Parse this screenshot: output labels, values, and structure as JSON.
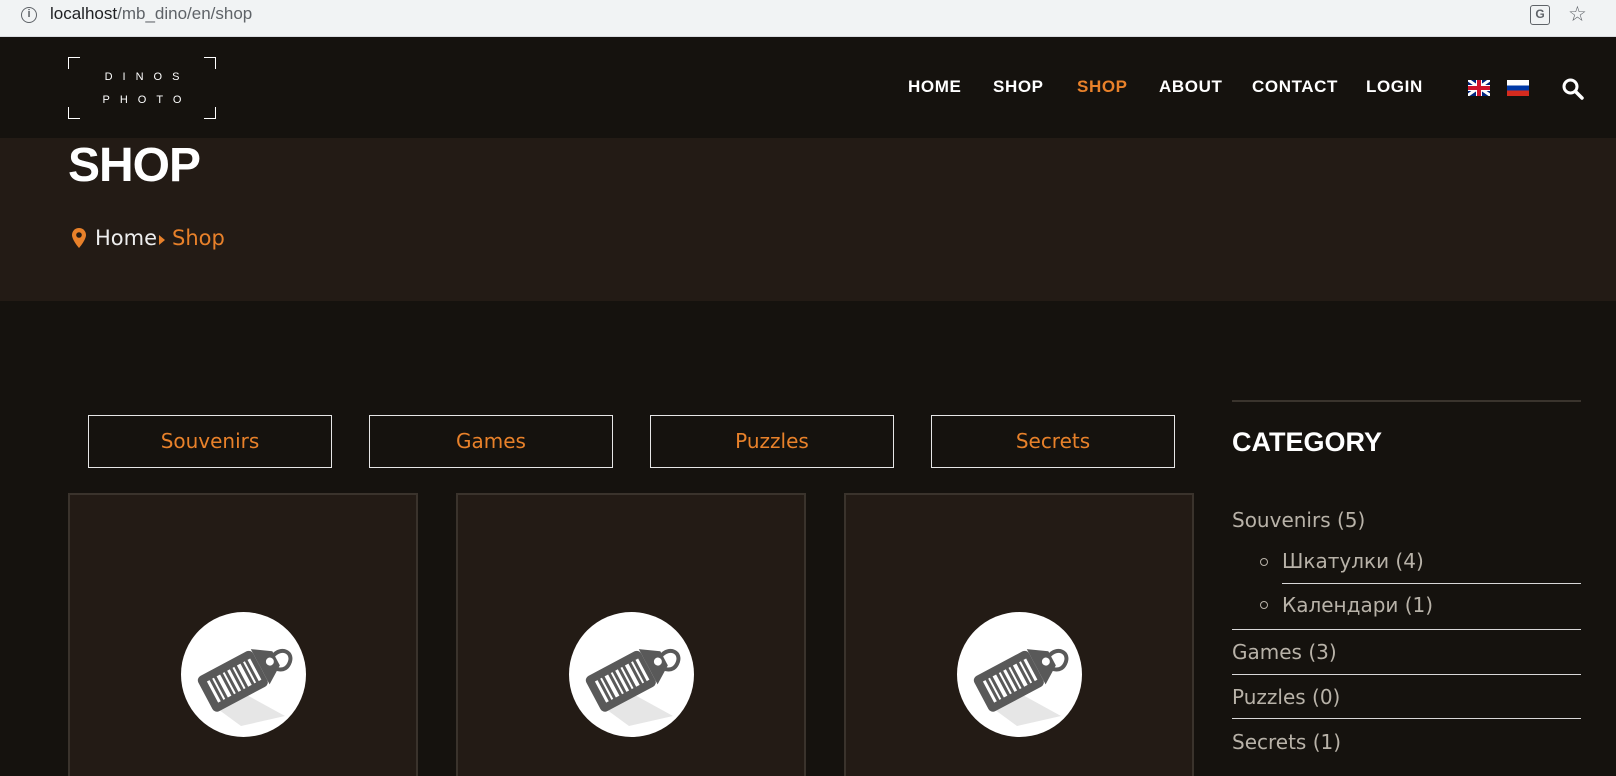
{
  "browser": {
    "url_host": "localhost",
    "url_path": "/mb_dino/en/shop"
  },
  "header": {
    "logo_line1": "DINOS",
    "logo_line2": "PHOTO",
    "nav": [
      {
        "label": "HOME",
        "active": false
      },
      {
        "label": "SHOP",
        "active": false
      },
      {
        "label": "SHOP",
        "active": true
      },
      {
        "label": "ABOUT",
        "active": false
      },
      {
        "label": "CONTACT",
        "active": false
      },
      {
        "label": "LOGIN",
        "active": false
      }
    ],
    "languages": [
      "en-flag-icon",
      "ru-flag-icon"
    ],
    "search_icon": "search-icon"
  },
  "page": {
    "title": "SHOP",
    "breadcrumb": {
      "home": "Home",
      "current": "Shop"
    }
  },
  "categories": [
    "Souvenirs",
    "Games",
    "Puzzles",
    "Secrets"
  ],
  "products": [
    {
      "image": "price-tag-icon"
    },
    {
      "image": "price-tag-icon"
    },
    {
      "image": "price-tag-icon"
    }
  ],
  "sidebar": {
    "title": "CATEGORY",
    "items": [
      {
        "label": "Souvenirs (5)",
        "children": [
          "Шкатулки (4)",
          "Календари (1)"
        ]
      },
      {
        "label": "Games (3)"
      },
      {
        "label": "Puzzles (0)"
      },
      {
        "label": "Secrets (1)"
      }
    ]
  },
  "colors": {
    "accent": "#e8812a",
    "background": "#15120e",
    "panel": "#231b15"
  }
}
